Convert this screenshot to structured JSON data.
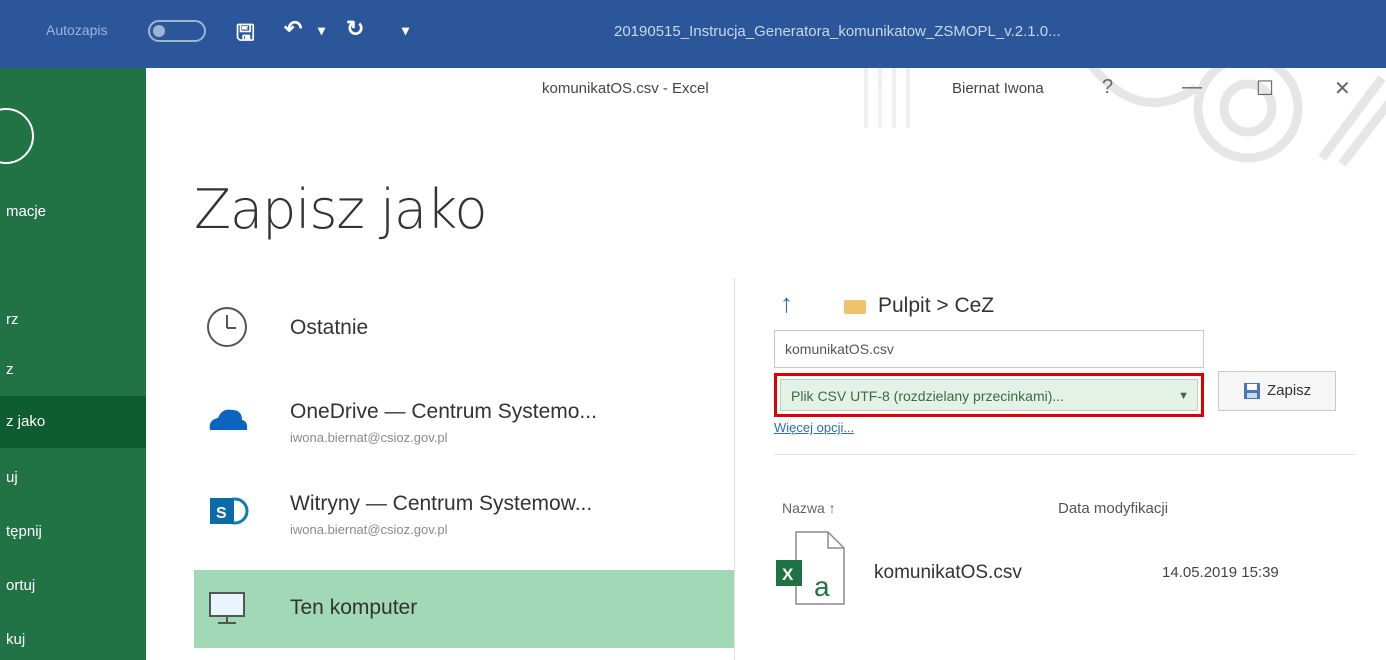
{
  "word_window": {
    "autosave_label": "Autozapis",
    "title": "20190515_Instrucja_Generatora_komunikatow_ZSMOPL_v.2.1.0..."
  },
  "excel_window": {
    "title": "komunikatOS.csv  -  Excel",
    "user": "Biernat Iwona",
    "help": "?",
    "minimize": "—",
    "restore": "☐",
    "close": "✕"
  },
  "backstage_nav": [
    {
      "label": "macje",
      "active": false
    },
    {
      "label": "rz",
      "active": false
    },
    {
      "label": "z",
      "active": false
    },
    {
      "label": "z jako",
      "active": true
    },
    {
      "label": "uj",
      "active": false
    },
    {
      "label": "tępnij",
      "active": false
    },
    {
      "label": "ortuj",
      "active": false
    },
    {
      "label": "kuj",
      "active": false
    }
  ],
  "page_heading": "Zapisz jako",
  "locations": [
    {
      "icon": "clock-icon",
      "title": "Ostatnie",
      "subtitle": ""
    },
    {
      "icon": "onedrive-cloud-icon",
      "title": "OneDrive — Centrum Systemo...",
      "subtitle": "iwona.biernat@csioz.gov.pl"
    },
    {
      "icon": "sharepoint-icon",
      "title": "Witryny — Centrum Systemow...",
      "subtitle": "iwona.biernat@csioz.gov.pl"
    },
    {
      "icon": "computer-icon",
      "title": "Ten komputer",
      "subtitle": ""
    }
  ],
  "save_panel": {
    "breadcrumb": "Pulpit > CeZ",
    "filename": "komunikatOS.csv",
    "file_type": "Plik CSV UTF-8 (rozdzielany przecinkami)...",
    "save_label": "Zapisz",
    "more_options": "Więcej opcji...",
    "columns": {
      "name": "Nazwa ↑",
      "date": "Data modyfikacji"
    },
    "files": [
      {
        "name": "komunikatOS.csv",
        "date": "14.05.2019 15:39"
      }
    ]
  },
  "colors": {
    "word_blue": "#2b579a",
    "excel_green": "#217346",
    "selected_location": "#a1d8b5",
    "highlight_red": "#e00000"
  }
}
